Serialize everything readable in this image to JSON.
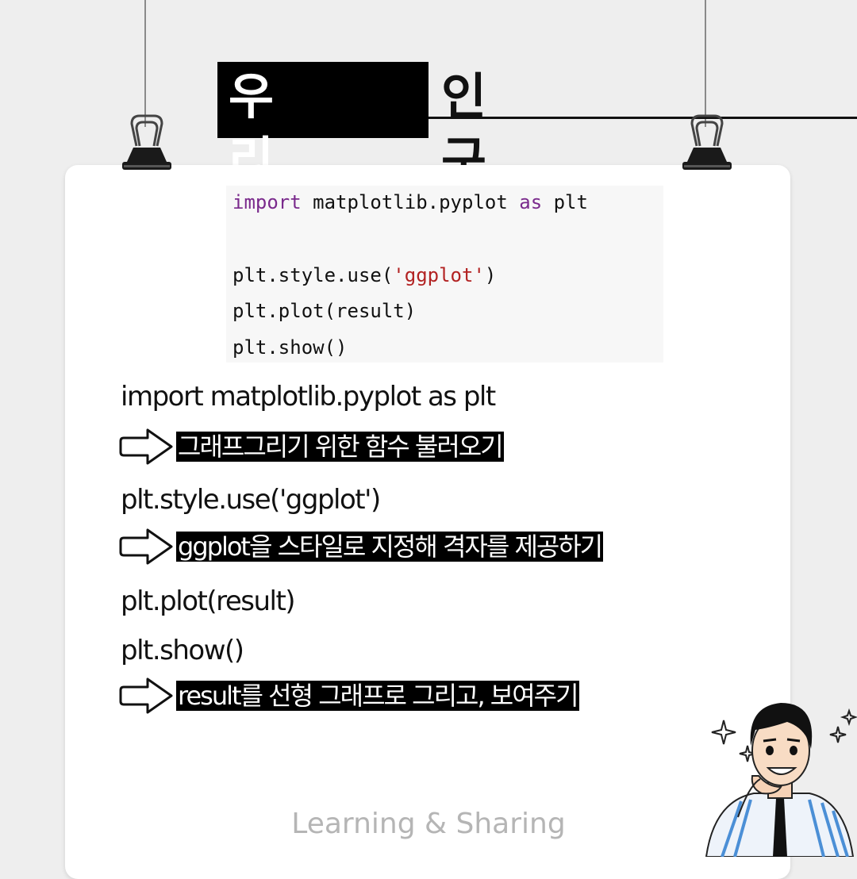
{
  "title": {
    "highlight": "우리동네",
    "rest": "인구분석"
  },
  "code_block": {
    "line1": {
      "kw1": "import",
      "mid": " matplotlib.pyplot ",
      "kw2": "as",
      "end": " plt"
    },
    "line2": {
      "pre": "plt.style.use(",
      "str": "'ggplot'",
      "post": ")"
    },
    "line3": "plt.plot(result)",
    "line4": "plt.show()"
  },
  "explanations": [
    {
      "code": "import matplotlib.pyplot as plt",
      "note": "그래프그리기 위한 함수 불러오기"
    },
    {
      "code": "plt.style.use('ggplot')",
      "note": "ggplot을 스타일로 지정해 격자를 제공하기"
    },
    {
      "code_lines": [
        "plt.plot(result)",
        "plt.show()"
      ],
      "note": "result를 선형 그래프로 그리고, 보여주기"
    }
  ],
  "footer": "Learning & Sharing",
  "icons": {
    "arrow": "right-arrow-outline-icon",
    "clip": "binder-clip-icon"
  },
  "colors": {
    "background": "#eeeeee",
    "card": "#ffffff",
    "highlight_bg": "#000000",
    "keyword": "#7a2a8c",
    "string": "#b22222",
    "footer": "#b5b5b5"
  }
}
